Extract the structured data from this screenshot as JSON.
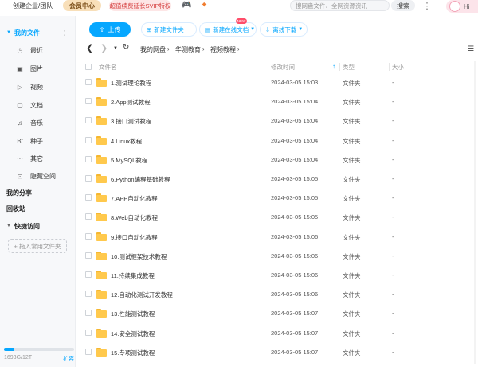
{
  "topbar": {
    "create_label": "创建企业/团队",
    "vip_label": "会员中心",
    "svip_label": "超值续费延长SVIP特权",
    "game_icon": "gamepad-icon",
    "gift_icon": "gift-icon",
    "search_placeholder": "搜网盘文件、全网资源资讯",
    "search_button": "搜索",
    "more_icon": "more-vertical-icon",
    "user_label": "Hi"
  },
  "sidebar": {
    "my_files": "我的文件",
    "items": [
      {
        "icon": "clock-icon",
        "glyph": "◷",
        "label": "最近"
      },
      {
        "icon": "image-icon",
        "glyph": "▣",
        "label": "图片"
      },
      {
        "icon": "video-icon",
        "glyph": "▷",
        "label": "视频"
      },
      {
        "icon": "document-icon",
        "glyph": "▢",
        "label": "文档"
      },
      {
        "icon": "music-icon",
        "glyph": "♫",
        "label": "音乐"
      },
      {
        "icon": "bt-icon",
        "glyph": "Bt",
        "label": "种子"
      },
      {
        "icon": "more-icon",
        "glyph": "···",
        "label": "其它"
      },
      {
        "icon": "lock-icon",
        "glyph": "⊡",
        "label": "隐藏空间"
      }
    ],
    "my_share": "我的分享",
    "recycle": "回收站",
    "quick_access": "快捷访问",
    "drag_hint": "+ 拖入常用文件夹",
    "quota_text": "1693G/12T",
    "quota_used": 0.14,
    "expand": "扩容"
  },
  "toolbar": {
    "upload": "上传",
    "new_folder": "新建文件夹",
    "new_online_doc": "新建在线文档",
    "new_badge": "NEW",
    "offline_download": "离线下载"
  },
  "breadcrumb": [
    "我的网盘",
    "华测教育",
    "视频教程"
  ],
  "table": {
    "col_name": "文件名",
    "col_time": "修改时间",
    "col_type": "类型",
    "col_size": "大小",
    "rows": [
      {
        "name": "1.测试理论教程",
        "time": "2024-03-05 15:03",
        "type": "文件夹",
        "size": "-"
      },
      {
        "name": "2.App测试教程",
        "time": "2024-03-05 15:04",
        "type": "文件夹",
        "size": "-"
      },
      {
        "name": "3.接口测试教程",
        "time": "2024-03-05 15:04",
        "type": "文件夹",
        "size": "-"
      },
      {
        "name": "4.Linux教程",
        "time": "2024-03-05 15:04",
        "type": "文件夹",
        "size": "-"
      },
      {
        "name": "5.MySQL教程",
        "time": "2024-03-05 15:04",
        "type": "文件夹",
        "size": "-"
      },
      {
        "name": "6.Python编程基础教程",
        "time": "2024-03-05 15:05",
        "type": "文件夹",
        "size": "-"
      },
      {
        "name": "7.APP自动化教程",
        "time": "2024-03-05 15:05",
        "type": "文件夹",
        "size": "-"
      },
      {
        "name": "8.Web自动化教程",
        "time": "2024-03-05 15:05",
        "type": "文件夹",
        "size": "-"
      },
      {
        "name": "9.接口自动化教程",
        "time": "2024-03-05 15:06",
        "type": "文件夹",
        "size": "-"
      },
      {
        "name": "10.测试框架技术教程",
        "time": "2024-03-05 15:06",
        "type": "文件夹",
        "size": "-"
      },
      {
        "name": "11.持续集成教程",
        "time": "2024-03-05 15:06",
        "type": "文件夹",
        "size": "-"
      },
      {
        "name": "12.自动化测试开发教程",
        "time": "2024-03-05 15:06",
        "type": "文件夹",
        "size": "-"
      },
      {
        "name": "13.性能测试教程",
        "time": "2024-03-05 15:07",
        "type": "文件夹",
        "size": "-"
      },
      {
        "name": "14.安全测试教程",
        "time": "2024-03-05 15:07",
        "type": "文件夹",
        "size": "-"
      },
      {
        "name": "15.专项测试教程",
        "time": "2024-03-05 15:07",
        "type": "文件夹",
        "size": "-"
      }
    ]
  }
}
